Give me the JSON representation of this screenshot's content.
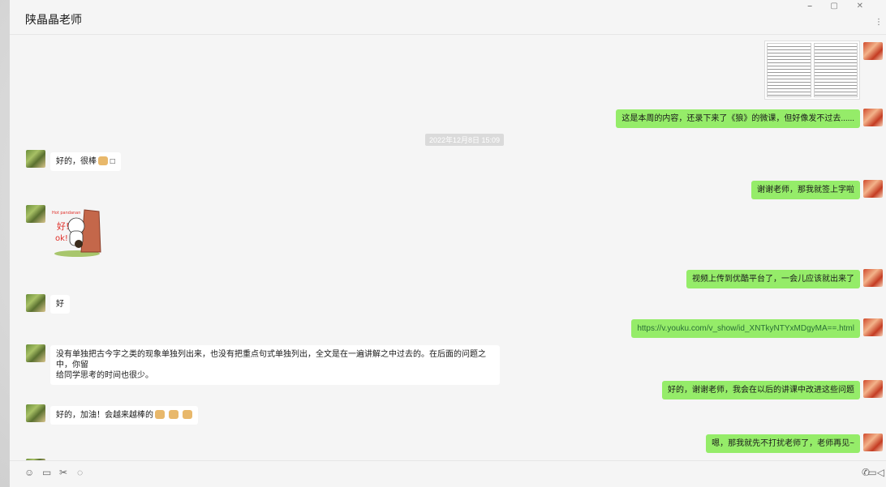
{
  "window": {
    "title": "陕晶晶老师",
    "controls": "⎯  ▢  ✕",
    "more": "⋮"
  },
  "timestamp": "2022年12月8日 15:09",
  "messages": [
    {
      "side": "right",
      "text": "这是本周的内容，还录下来了《狼》的微课，但好像发不过去......"
    },
    {
      "side": "left",
      "text": "好的，很棒"
    },
    {
      "side": "right",
      "text": "谢谢老师，那我就签上字啦"
    },
    {
      "side": "left",
      "sticker_text": "好!",
      "sticker_text2": "ok!",
      "sticker_caption": "Hot pandanan"
    },
    {
      "side": "right",
      "text": "视频上传到优酷平台了，一会儿应该就出来了"
    },
    {
      "side": "left",
      "text": "好"
    },
    {
      "side": "right",
      "text": "https://v.youku.com/v_show/id_XNTkyNTYxMDgyMA==.html"
    },
    {
      "side": "left",
      "text": "没有单独把古今字之类的现象单独列出来，也没有把重点句式单独列出，全文是在一遍讲解之中过去的。在后面的问题之中，你留",
      "text2": "给同学思考的时间也很少。"
    },
    {
      "side": "right",
      "text": "好的，谢谢老师，我会在以后的讲课中改进这些问题"
    },
    {
      "side": "left",
      "text": "好的，加油！会越来越棒的"
    },
    {
      "side": "right",
      "text": "嗯，那我就先不打扰老师了，老师再见~"
    }
  ],
  "toolbar": {
    "emoji": "☺",
    "file": "▭",
    "scissors": "✂",
    "chat": "◌",
    "phone": "✆",
    "video": "▭◁"
  },
  "colors": {
    "right_bubble": "#95ec69",
    "left_bubble": "#ffffff",
    "background": "#f5f5f5"
  }
}
